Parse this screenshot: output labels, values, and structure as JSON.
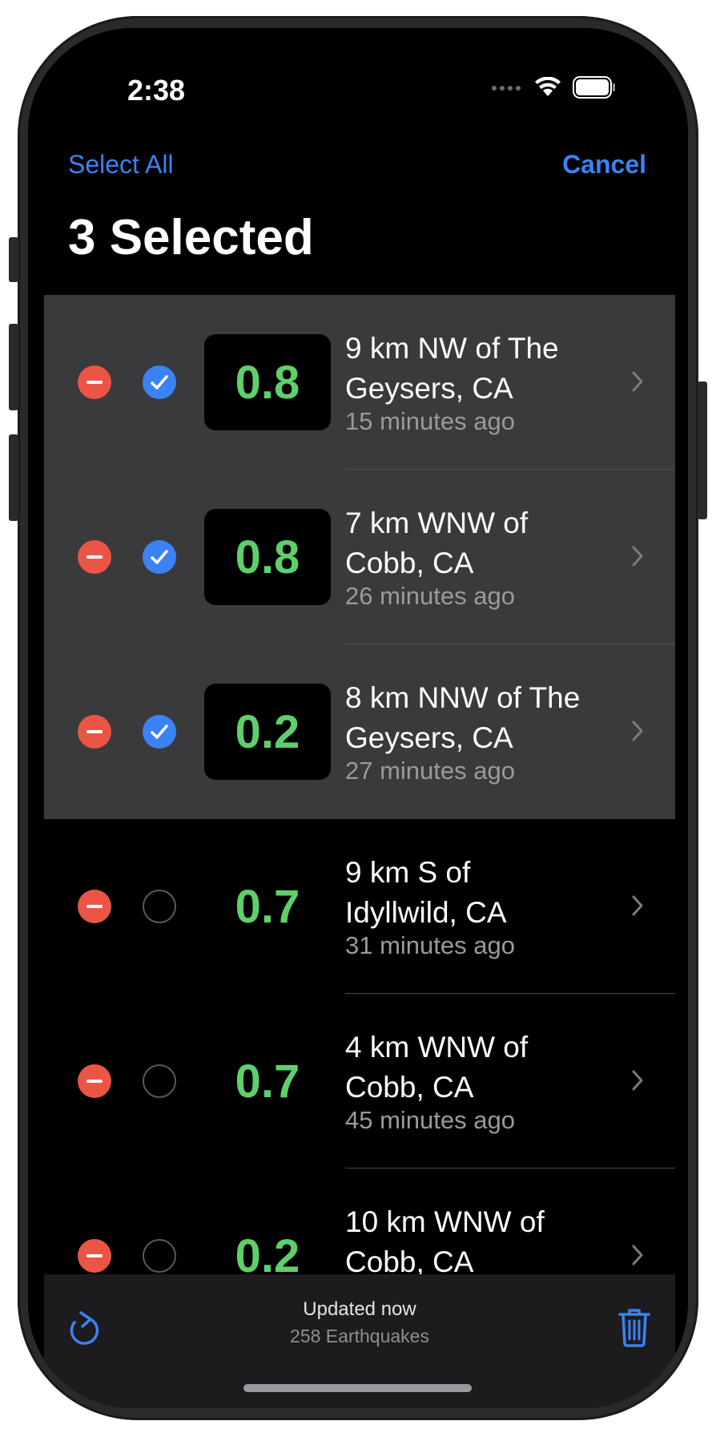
{
  "status": {
    "time": "2:38"
  },
  "nav": {
    "select_all": "Select All",
    "cancel": "Cancel",
    "title": "3 Selected"
  },
  "rows": [
    {
      "magnitude": "0.8",
      "place": "9 km NW of The Geysers, CA",
      "ago": "15 minutes ago",
      "selected": true
    },
    {
      "magnitude": "0.8",
      "place": "7 km WNW of Cobb, CA",
      "ago": "26 minutes ago",
      "selected": true
    },
    {
      "magnitude": "0.2",
      "place": "8 km NNW of The Geysers, CA",
      "ago": "27 minutes ago",
      "selected": true
    },
    {
      "magnitude": "0.7",
      "place": "9 km S of Idyllwild, CA",
      "ago": "31 minutes ago",
      "selected": false
    },
    {
      "magnitude": "0.7",
      "place": "4 km WNW of Cobb, CA",
      "ago": "45 minutes ago",
      "selected": false
    },
    {
      "magnitude": "0.2",
      "place": "10 km WNW of Cobb, CA",
      "ago": "",
      "selected": false
    }
  ],
  "toolbar": {
    "updated": "Updated now",
    "count": "258 Earthquakes"
  },
  "colors": {
    "accent": "#3b82f6",
    "delete": "#eb5545",
    "magnitude": "#5fcf6b",
    "selected_row": "#3a3a3c"
  }
}
